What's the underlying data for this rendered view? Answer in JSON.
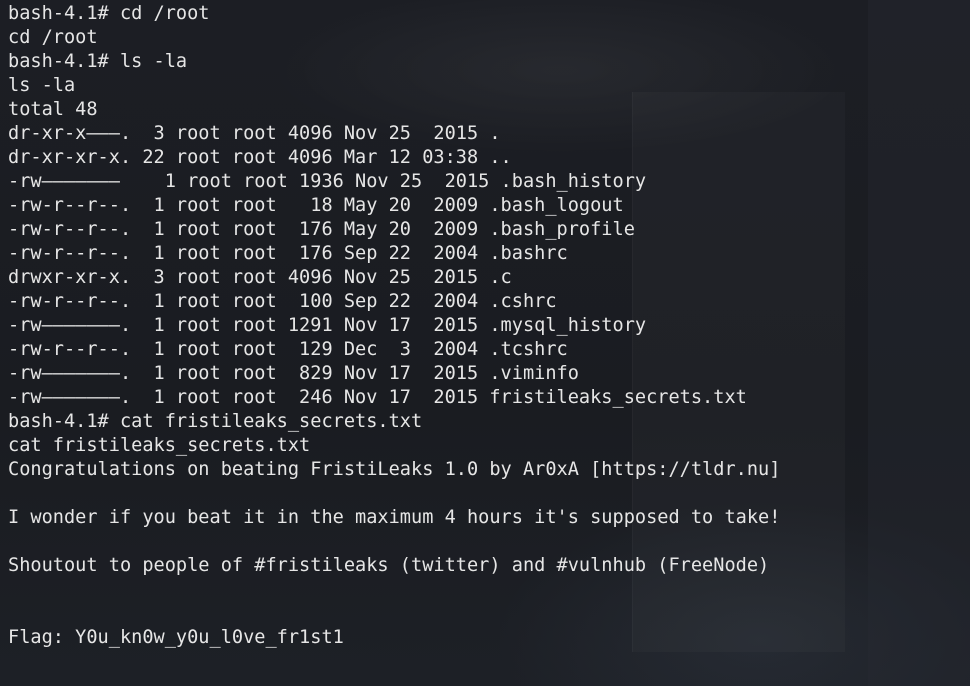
{
  "terminal": {
    "lines": [
      "bash-4.1# cd /root",
      "cd /root",
      "bash-4.1# ls -la",
      "ls -la",
      "total 48",
      "dr-xr-x———.  3 root root 4096 Nov 25  2015 .",
      "dr-xr-xr-x. 22 root root 4096 Mar 12 03:38 ..",
      "-rw———————    1 root root 1936 Nov 25  2015 .bash_history",
      "-rw-r--r--.  1 root root   18 May 20  2009 .bash_logout",
      "-rw-r--r--.  1 root root  176 May 20  2009 .bash_profile",
      "-rw-r--r--.  1 root root  176 Sep 22  2004 .bashrc",
      "drwxr-xr-x.  3 root root 4096 Nov 25  2015 .c",
      "-rw-r--r--.  1 root root  100 Sep 22  2004 .cshrc",
      "-rw———————.  1 root root 1291 Nov 17  2015 .mysql_history",
      "-rw-r--r--.  1 root root  129 Dec  3  2004 .tcshrc",
      "-rw———————.  1 root root  829 Nov 17  2015 .viminfo",
      "-rw———————.  1 root root  246 Nov 17  2015 fristileaks_secrets.txt",
      "bash-4.1# cat fristileaks_secrets.txt",
      "cat fristileaks_secrets.txt",
      "Congratulations on beating FristiLeaks 1.0 by Ar0xA [https://tldr.nu]",
      "",
      "I wonder if you beat it in the maximum 4 hours it's supposed to take!",
      "",
      "Shoutout to people of #fristileaks (twitter) and #vulnhub (FreeNode)",
      "",
      "",
      "Flag: Y0u_kn0w_y0u_l0ve_fr1st1"
    ]
  }
}
